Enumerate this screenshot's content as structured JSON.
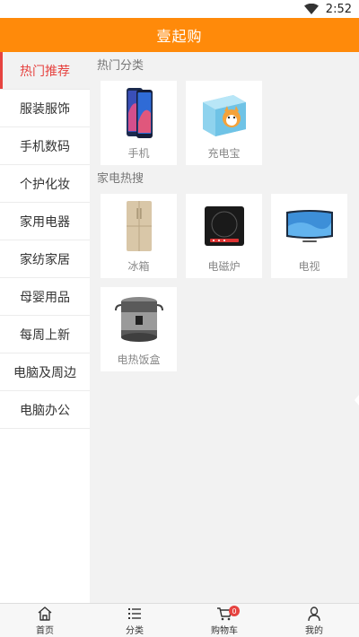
{
  "status_bar": {
    "time": "2:52"
  },
  "header": {
    "title": "壹起购"
  },
  "sidebar": {
    "items": [
      {
        "label": "热门推荐",
        "active": true
      },
      {
        "label": "服装服饰"
      },
      {
        "label": "手机数码"
      },
      {
        "label": "个护化妆"
      },
      {
        "label": "家用电器"
      },
      {
        "label": "家纺家居"
      },
      {
        "label": "母婴用品"
      },
      {
        "label": "每周上新"
      },
      {
        "label": "电脑及周边"
      },
      {
        "label": "电脑办公"
      }
    ]
  },
  "main": {
    "sections": [
      {
        "title": "热门分类",
        "items": [
          {
            "label": "手机",
            "icon": "phone-image"
          },
          {
            "label": "充电宝",
            "icon": "power-bank-image"
          }
        ]
      },
      {
        "title": "家电热搜",
        "items": [
          {
            "label": "冰箱",
            "icon": "fridge-image"
          },
          {
            "label": "电磁炉",
            "icon": "induction-cooker-image"
          },
          {
            "label": "电视",
            "icon": "tv-image"
          },
          {
            "label": "电热饭盒",
            "icon": "lunch-box-image"
          }
        ]
      }
    ]
  },
  "bottom_nav": {
    "items": [
      {
        "label": "首页",
        "icon": "home-icon"
      },
      {
        "label": "分类",
        "icon": "list-icon"
      },
      {
        "label": "购物车",
        "icon": "cart-icon",
        "badge": "0"
      },
      {
        "label": "我的",
        "icon": "user-icon"
      }
    ]
  },
  "colors": {
    "header_bg": "#ff8a0a",
    "active_text": "#e64340",
    "badge_bg": "#e64340"
  }
}
